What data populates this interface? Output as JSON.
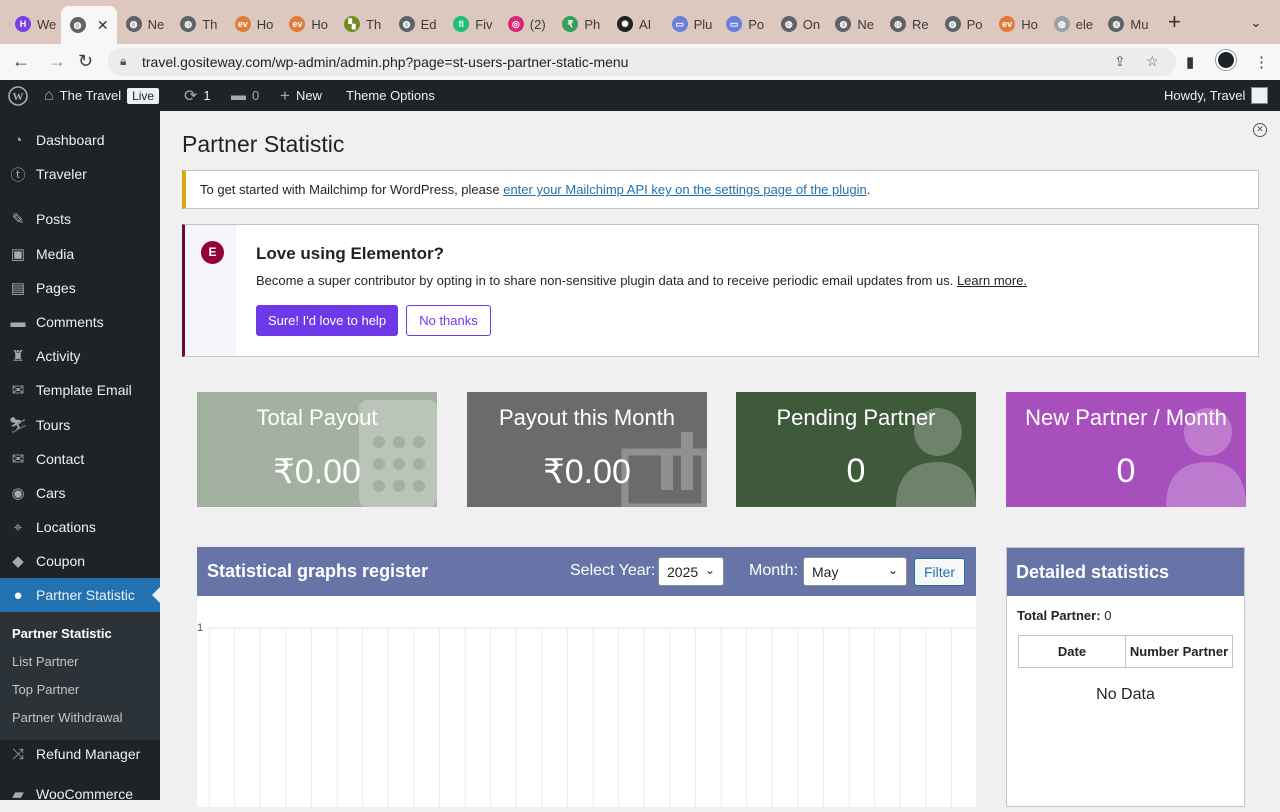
{
  "browser": {
    "tabs": [
      {
        "label": "We",
        "favicon": "letter-h-icon",
        "color": "#7b3fe4"
      },
      {
        "label": "",
        "favicon": "globe-icon",
        "color": "#5f6368",
        "active": true
      },
      {
        "label": "Ne",
        "favicon": "globe-icon",
        "color": "#5f6368"
      },
      {
        "label": "Th",
        "favicon": "globe-icon",
        "color": "#5f6368"
      },
      {
        "label": "Ho",
        "favicon": "ev-icon",
        "color": "#e07b39"
      },
      {
        "label": "Ho",
        "favicon": "ev-icon",
        "color": "#e07b39"
      },
      {
        "label": "Th",
        "favicon": "car-icon",
        "color": "#6b8e23"
      },
      {
        "label": "Ed",
        "favicon": "globe-icon",
        "color": "#5f6368"
      },
      {
        "label": "Fiv",
        "favicon": "fiverr-icon",
        "color": "#1dbf73"
      },
      {
        "label": "(2)",
        "favicon": "instagram-icon",
        "color": "#d62976"
      },
      {
        "label": "Ph",
        "favicon": "rupee-icon",
        "color": "#3a9d5d"
      },
      {
        "label": "AI",
        "favicon": "openai-icon",
        "color": "#202123"
      },
      {
        "label": "Plu",
        "favicon": "screen-icon",
        "color": "#6a7fdb"
      },
      {
        "label": "Po",
        "favicon": "screen-icon",
        "color": "#6a7fdb"
      },
      {
        "label": "On",
        "favicon": "globe-icon",
        "color": "#5f6368"
      },
      {
        "label": "Ne",
        "favicon": "globe-icon",
        "color": "#5f6368"
      },
      {
        "label": "Re",
        "favicon": "globe-icon",
        "color": "#5f6368"
      },
      {
        "label": "Po",
        "favicon": "globe-icon",
        "color": "#5f6368"
      },
      {
        "label": "Ho",
        "favicon": "ev-icon",
        "color": "#e07b39"
      },
      {
        "label": "ele",
        "favicon": "globe-icon",
        "color": "#9aa0a6"
      },
      {
        "label": "Mu",
        "favicon": "globe-icon",
        "color": "#5f6368"
      }
    ],
    "url": "travel.gositeway.com/wp-admin/admin.php?page=st-users-partner-static-menu"
  },
  "adminbar": {
    "site_name": "The Travel",
    "live_badge": "Live",
    "updates": "1",
    "comments": "0",
    "new_label": "New",
    "theme_options": "Theme Options",
    "howdy": "Howdy, Travel"
  },
  "sidebar": {
    "items": [
      {
        "label": "Dashboard",
        "icon": "dashboard-icon"
      },
      {
        "label": "Traveler",
        "icon": "traveler-icon"
      },
      {
        "label": "Posts",
        "icon": "pin-icon"
      },
      {
        "label": "Media",
        "icon": "media-icon"
      },
      {
        "label": "Pages",
        "icon": "pages-icon"
      },
      {
        "label": "Comments",
        "icon": "comment-icon"
      },
      {
        "label": "Activity",
        "icon": "activity-icon"
      },
      {
        "label": "Template Email",
        "icon": "email-icon"
      },
      {
        "label": "Tours",
        "icon": "tours-icon"
      },
      {
        "label": "Contact",
        "icon": "contact-icon"
      },
      {
        "label": "Cars",
        "icon": "cars-icon"
      },
      {
        "label": "Locations",
        "icon": "location-icon"
      },
      {
        "label": "Coupon",
        "icon": "tag-icon"
      },
      {
        "label": "Partner Statistic",
        "icon": "user-icon",
        "current": true
      },
      {
        "label": "Refund Manager",
        "icon": "shuffle-icon"
      },
      {
        "label": "WooCommerce",
        "icon": "woo-icon"
      }
    ],
    "submenu": [
      "Partner Statistic",
      "List Partner",
      "Top Partner",
      "Partner Withdrawal"
    ]
  },
  "main": {
    "title": "Partner Statistic",
    "mailchimp_notice": {
      "text": "To get started with Mailchimp for WordPress, please ",
      "link": "enter your Mailchimp API key on the settings page of the plugin",
      "suffix": "."
    },
    "elementor": {
      "title": "Love using Elementor?",
      "desc": "Become a super contributor by opting in to share non-sensitive plugin data and to receive periodic email updates from us. ",
      "learn_more": "Learn more.",
      "yes_button": "Sure! I'd love to help",
      "no_button": "No thanks"
    },
    "cards": [
      {
        "title": "Total Payout",
        "value": "₹0.00",
        "color": "#a3b1a0",
        "icon": "calculator-icon"
      },
      {
        "title": "Payout this Month",
        "value": "₹0.00",
        "color": "#6b6b6b",
        "icon": "bar-chart-icon"
      },
      {
        "title": "Pending Partner",
        "value": "0",
        "color": "#3e5a3a",
        "icon": "user-icon"
      },
      {
        "title": "New Partner / Month",
        "value": "0",
        "color": "#a84fbe",
        "icon": "user-icon"
      }
    ],
    "graph": {
      "title": "Statistical graphs register",
      "year_label": "Select Year:",
      "year_value": "2025",
      "month_label": "Month:",
      "month_value": "May",
      "filter_button": "Filter",
      "y_tick": "1"
    },
    "detail": {
      "title": "Detailed statistics",
      "total_label": "Total Partner:",
      "total_value": "0",
      "col_date": "Date",
      "col_number": "Number Partner",
      "no_data": "No Data"
    }
  }
}
